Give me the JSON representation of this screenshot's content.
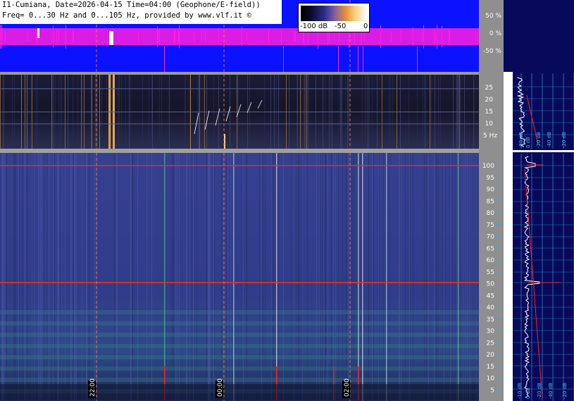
{
  "header": {
    "line1": "I1-Cumiana, Date=2026-04-15 Time=04:00 (Geophone/E-field))",
    "line2": "Freq= 0...30 Hz and 0...105 Hz, provided by www.vlf.it ©"
  },
  "colorbar": {
    "labels": [
      "-100 dB",
      "-50",
      "0"
    ]
  },
  "amplitude_panel": {
    "ticks": [
      "50 %",
      "0 %",
      "-50 %"
    ]
  },
  "low_freq_panel": {
    "ticks": [
      "25",
      "20",
      "15",
      "10",
      "5 Hz"
    ]
  },
  "high_freq_panel": {
    "ticks": [
      "100",
      "95",
      "90",
      "85",
      "80",
      "75",
      "70",
      "65",
      "60",
      "55",
      "50",
      "45",
      "40",
      "35",
      "30",
      "25",
      "20",
      "15",
      "10",
      "5"
    ]
  },
  "time_markers": [
    "22:00",
    "00:00",
    "02:00"
  ],
  "spectrum_labels_top": [
    "-20 dB",
    "0 dB",
    "-20 dB",
    "-40 dB",
    "-20 dB"
  ],
  "spectrum_labels_bottom": [
    "-10 dB",
    "0 dB",
    "-20 dB",
    "-40 dB",
    "-20 dB"
  ],
  "colors": {
    "amp_bg": "#0a12ff",
    "amp_trace": "#ff20e0",
    "spectro_bg": "#2c3a8a",
    "right_panel_bg": "#070a5a",
    "grid_cyan": "#3fa6d8",
    "red_line": "#ff2020"
  }
}
